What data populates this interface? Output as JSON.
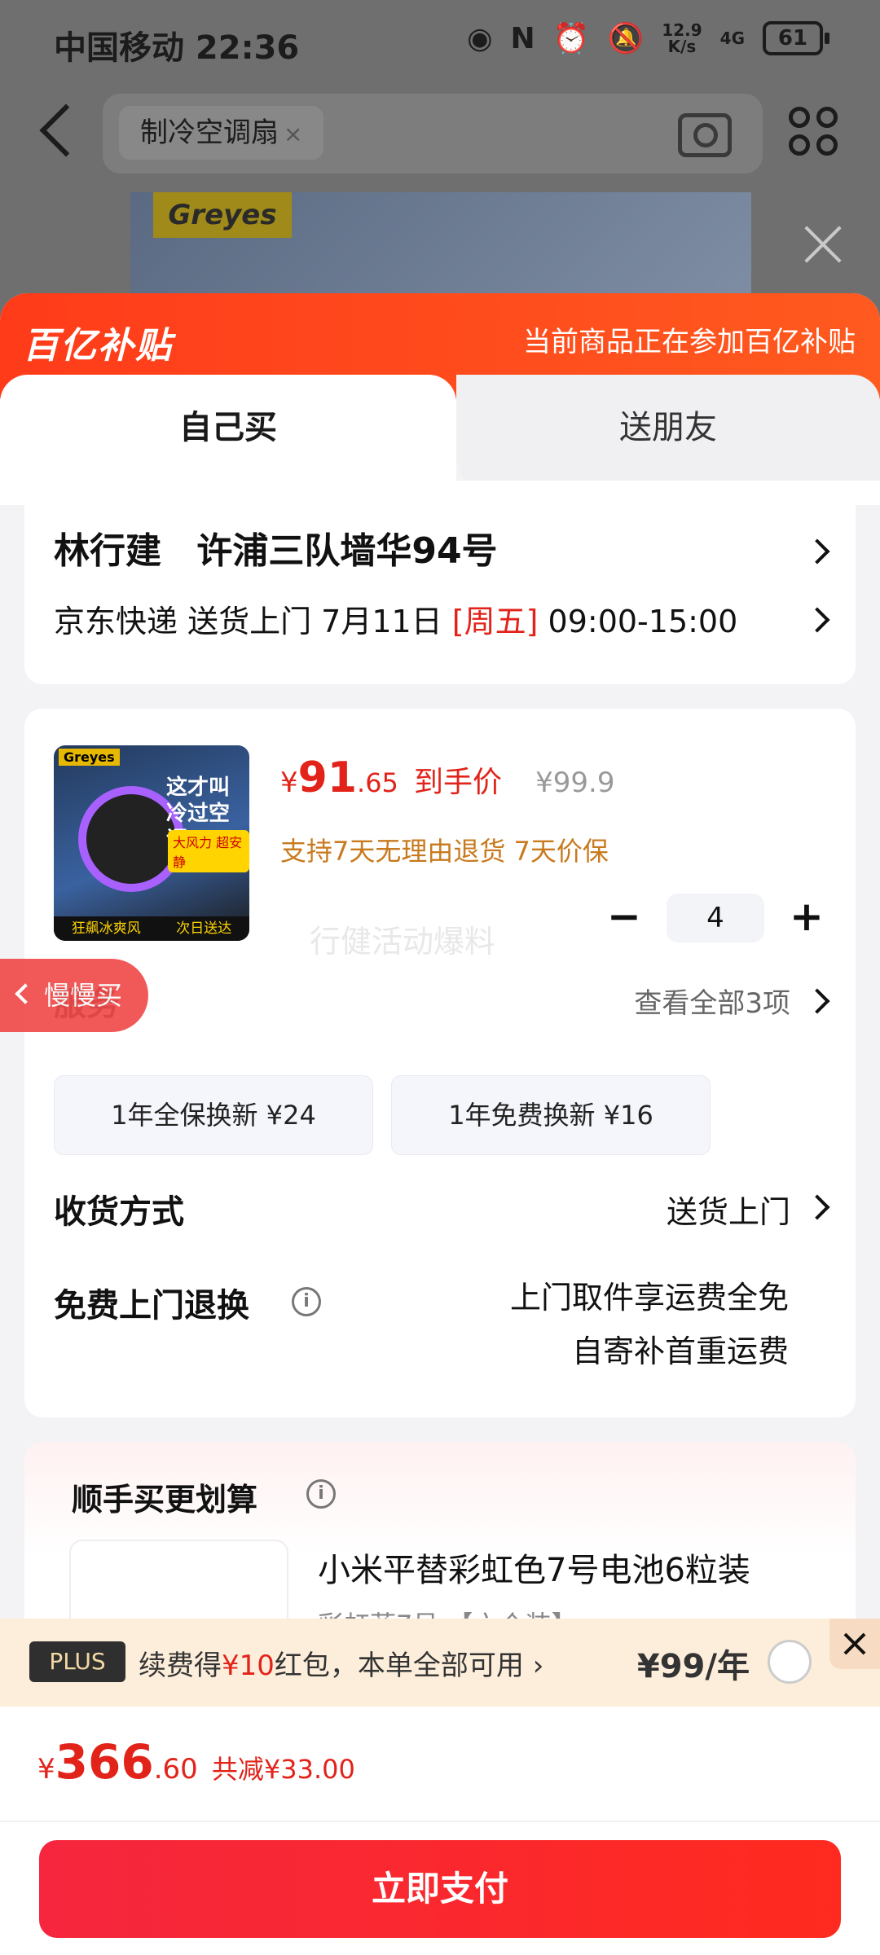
{
  "status_bar": {
    "carrier_time": "中国移动 22:36",
    "net_speed": "12.9\nK/s",
    "net_type": "4G",
    "battery": "61"
  },
  "search": {
    "chip": "制冷空调扇"
  },
  "banner": {
    "brand": "Greyes"
  },
  "promo": {
    "logo": "百亿补贴",
    "text": "当前商品正在参加百亿补贴"
  },
  "tabs": [
    {
      "label": "自己买",
      "active": true
    },
    {
      "label": "送朋友",
      "active": false
    }
  ],
  "address": {
    "name": "林行建",
    "detail": "许浦三队墙华94号",
    "delivery_prefix": "京东快递 送货上门 7月11日",
    "weekday": "[周五]",
    "time_window": "09:00-15:00"
  },
  "product": {
    "image_texts": {
      "brand": "Greyes",
      "headline": "这才叫冷过空调",
      "tag": "大风力 超安静",
      "footer_left": "狂飙冰爽风",
      "footer_right": "次日送达"
    },
    "price_currency": "¥",
    "price_int": "91",
    "price_dec": ".65",
    "price_label": "到手价",
    "orig_price": "¥99.9",
    "promise": "支持7天无理由退货  7天价保",
    "watermark": "行健活动爆料",
    "quantity": "4",
    "minus": "−",
    "plus": "+"
  },
  "services": {
    "title": "服务",
    "view_all": "查看全部3项",
    "options": [
      "1年全保换新  ¥24",
      "1年免费换新  ¥16"
    ]
  },
  "delivery_method": {
    "title": "收货方式",
    "value": "送货上门"
  },
  "return": {
    "title": "免费上门退换",
    "line1": "上门取件享运费全免",
    "line2": "自寄补首重运费"
  },
  "bundle": {
    "title": "顺手买更划算",
    "product_name": "小米平替彩虹色7号电池6粒装",
    "product_sub": "彩虹蓝7号 【六个装】"
  },
  "plus_bar": {
    "badge": "PLUS",
    "text_prefix": "续费得",
    "text_red": "¥10",
    "text_suffix": "红包，本单全部可用",
    "price": "¥99/年"
  },
  "footer": {
    "currency": "¥",
    "total_int": "366",
    "total_dec": ".60",
    "discount": "共减¥33.00",
    "pay_label": "立即支付"
  },
  "float_tab": {
    "label": "慢慢买"
  },
  "colors": {
    "accent_red": "#e2231a",
    "promo_orange": "#ff4a1c",
    "pay_button": "#f5263e"
  }
}
